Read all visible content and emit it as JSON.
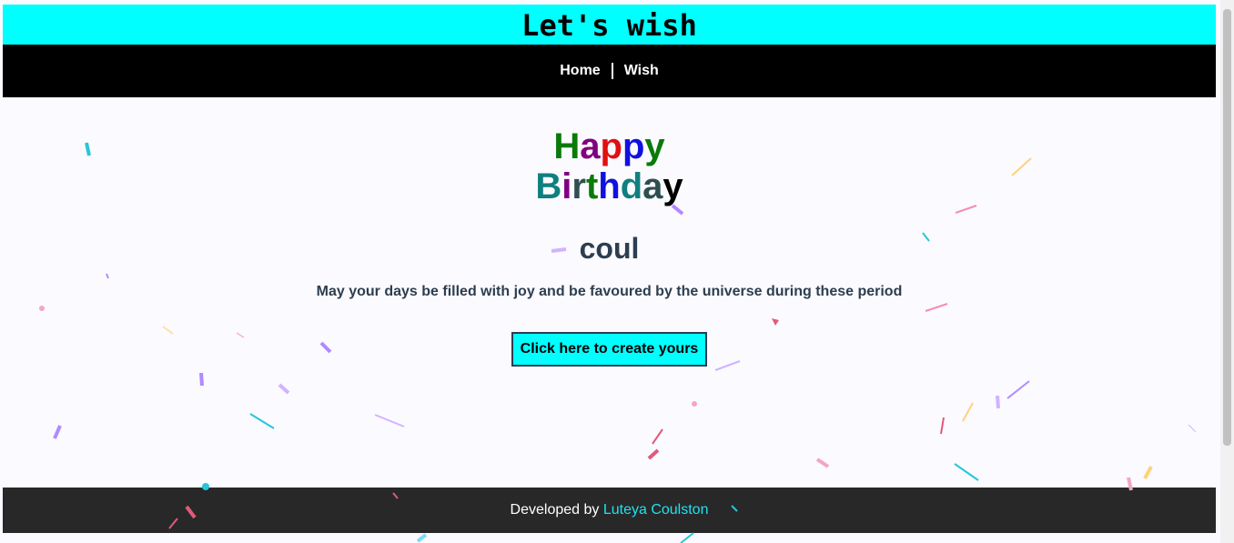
{
  "header": {
    "title": "Let's wish"
  },
  "nav": {
    "items": [
      {
        "label": "Home"
      },
      {
        "label": "Wish"
      }
    ]
  },
  "greeting": {
    "line1": [
      {
        "char": "H",
        "color": "#0a7a0a"
      },
      {
        "char": "a",
        "color": "#800080"
      },
      {
        "char": "p",
        "color": "#e01010"
      },
      {
        "char": "p",
        "color": "#1010e0"
      },
      {
        "char": "y",
        "color": "#0a7a0a"
      }
    ],
    "line2": [
      {
        "char": "B",
        "color": "#0f7f7f"
      },
      {
        "char": "i",
        "color": "#800080"
      },
      {
        "char": "r",
        "color": "#2f4f4f"
      },
      {
        "char": "t",
        "color": "#0a7a0a"
      },
      {
        "char": "h",
        "color": "#1010e0"
      },
      {
        "char": "d",
        "color": "#0f7f7f"
      },
      {
        "char": "a",
        "color": "#2f4f4f"
      },
      {
        "char": "y",
        "color": "#000000"
      }
    ]
  },
  "recipient": {
    "name": "coul"
  },
  "message": {
    "text": "May your days be filled with joy and be favoured by the universe during these period"
  },
  "cta": {
    "label": "Click here to create yours"
  },
  "footer": {
    "prefix": "Developed by ",
    "author": "Luteya Coulston"
  },
  "colors": {
    "accent": "#00ffff",
    "nav_bg": "#000000",
    "footer_bg": "#282828",
    "link": "#1ee3f2",
    "text": "#2c3e50"
  }
}
